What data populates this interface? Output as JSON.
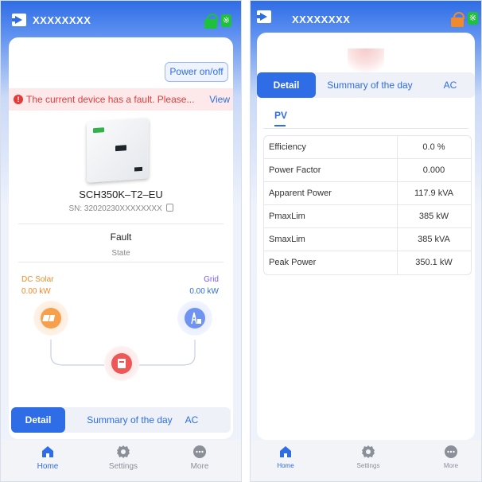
{
  "left_screen": {
    "device_name": "XXXXXXXX",
    "power_button": "Power on/off",
    "fault_message": "The current device has a fault. Please...",
    "fault_view": "View",
    "model": "SCH350K–T2–EU",
    "serial": "SN: 32020230XXXXXXXX",
    "state_value": "Fault",
    "state_label": "State",
    "dc_solar_label": "DC Solar",
    "dc_solar_value": "0.00 kW",
    "grid_label": "Grid",
    "grid_value": "0.00 kW",
    "tabs": [
      "Detail",
      "Summary of the day",
      "AC"
    ]
  },
  "right_screen": {
    "device_name": "XXXXXXXX",
    "tabs": [
      "Detail",
      "Summary of the day",
      "AC"
    ],
    "sub_tab": "PV",
    "rows": [
      {
        "label": "Efficiency",
        "value": "0.0 %"
      },
      {
        "label": "Power Factor",
        "value": "0.000"
      },
      {
        "label": "Apparent Power",
        "value": "117.9 kVA"
      },
      {
        "label": "PmaxLim",
        "value": "385 kW"
      },
      {
        "label": "SmaxLim",
        "value": "385 kVA"
      },
      {
        "label": "Peak Power",
        "value": "350.1 kW"
      }
    ]
  },
  "nav": [
    "Home",
    "Settings",
    "More"
  ],
  "icons": {
    "exit": "exit-icon",
    "router": "router-icon",
    "bluetooth": "bluetooth-icon",
    "fault": "alert-icon",
    "copy": "copy-icon",
    "solar": "solar-panel-icon",
    "grid": "power-tower-icon",
    "inverter": "inverter-icon",
    "home": "home-icon",
    "settings": "gear-icon",
    "more": "more-icon"
  },
  "colors": {
    "primary": "#2f6de6",
    "fault": "#e23b3b",
    "solar": "#f08a2c",
    "grid": "#7a5cf0",
    "online": "#1ec23a",
    "offline": "#f08a2c"
  }
}
